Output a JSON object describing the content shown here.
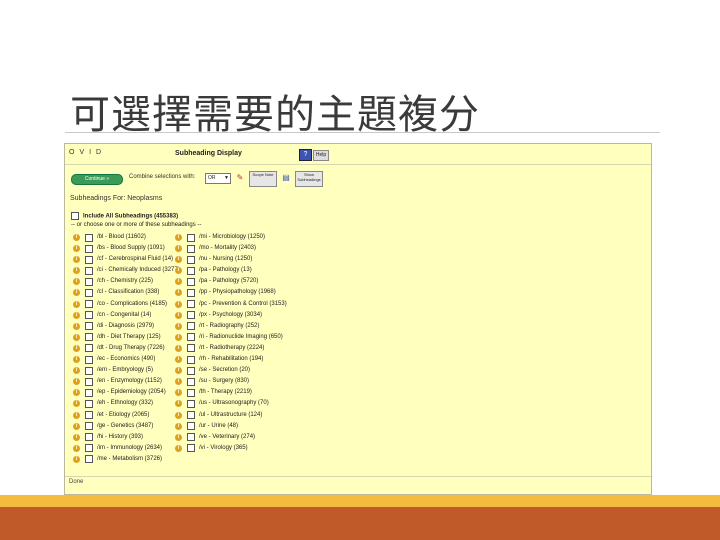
{
  "slide": {
    "title": "可選擇需要的主題複分"
  },
  "app": {
    "brand": "OVID",
    "dialog_title": "Subheading Display",
    "help_label": "Help",
    "continue_label": "Continue »",
    "combine_label": "Combine selections with:",
    "combine_value": "OR",
    "scope_note_label": "Scope Note",
    "show_subheadings_label": "Show Subheadings"
  },
  "subheadings_for": "Subheadings For: Neoplasms",
  "include_all": "Include All Subheadings (455383)",
  "choose_note": "-- or choose one or more of these subheadings --",
  "subheadings_left": [
    "/bl - Blood (11602)",
    "/bs - Blood Supply (1091)",
    "/cf - Cerebrospinal Fluid (14)",
    "/ci - Chemically Induced (3277)",
    "/ch - Chemistry (225)",
    "/cl - Classification (338)",
    "/co - Complications (4185)",
    "/cn - Congenital (14)",
    "/di - Diagnosis (2979)",
    "/dh - Diet Therapy (125)",
    "/dt - Drug Therapy (7226)",
    "/ec - Economics (490)",
    "/em - Embryology (5)",
    "/en - Enzymology (1152)",
    "/ep - Epidemiology (2054)",
    "/eh - Ethnology (332)",
    "/et - Etiology (2065)",
    "/ge - Genetics (3487)",
    "/hi - History (393)",
    "/im - Immunology (2634)",
    "/me - Metabolism (3726)"
  ],
  "subheadings_right": [
    "/mi - Microbiology (1250)",
    "/mo - Mortality (2403)",
    "/nu - Nursing (1250)",
    "/pa - Pathology (13)",
    "/pa - Pathology (5720)",
    "/pp - Physiopathology (1968)",
    "/pc - Prevention & Control (3153)",
    "/px - Psychology (3034)",
    "/rt - Radiography (252)",
    "/ri - Radionuclide Imaging (650)",
    "/rt - Radiotherapy (2224)",
    "/rh - Rehabilitation (194)",
    "/se - Secretion (20)",
    "/su - Surgery (830)",
    "/th - Therapy (2219)",
    "/us - Ultrasonography (70)",
    "/ul - Ultrastructure (124)",
    "/ur - Urine (48)",
    "/ve - Veterinary (274)",
    "/vi - Virology (365)"
  ],
  "status_text": "Done",
  "colors": {
    "panel_bg": "#ffffbe",
    "continue_green": "#3b9b56",
    "help_blue": "#3d52b5",
    "info_orange": "#e0a11a",
    "band_gold": "#f3bc3e",
    "band_rust": "#c05a29"
  }
}
